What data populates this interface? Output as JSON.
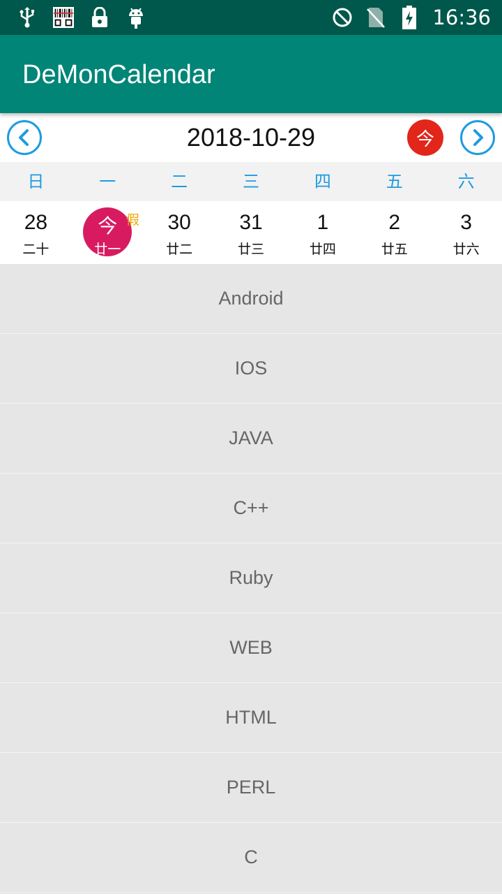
{
  "status_bar": {
    "time": "16:36",
    "left_icons": [
      "usb-icon",
      "barcode-icon",
      "lock-icon",
      "android-icon"
    ],
    "right_icons": [
      "do-not-disturb-icon",
      "no-sim-icon",
      "battery-charging-icon"
    ]
  },
  "app_bar": {
    "title": "DeMonCalendar"
  },
  "calendar": {
    "current_date": "2018-10-29",
    "today_label": "今",
    "weekdays": [
      "日",
      "一",
      "二",
      "三",
      "四",
      "五",
      "六"
    ],
    "days": [
      {
        "day": "28",
        "lunar": "二十",
        "selected": false
      },
      {
        "day": "今",
        "lunar": "廿一",
        "selected": true,
        "mark": "假"
      },
      {
        "day": "30",
        "lunar": "廿二",
        "selected": false
      },
      {
        "day": "31",
        "lunar": "廿三",
        "selected": false
      },
      {
        "day": "1",
        "lunar": "廿四",
        "selected": false
      },
      {
        "day": "2",
        "lunar": "廿五",
        "selected": false
      },
      {
        "day": "3",
        "lunar": "廿六",
        "selected": false
      }
    ]
  },
  "list": {
    "items": [
      "Android",
      "IOS",
      "JAVA",
      "C++",
      "Ruby",
      "WEB",
      "HTML",
      "PERL",
      "C"
    ]
  },
  "colors": {
    "status_bar": "#00574b",
    "app_bar": "#008577",
    "accent_blue": "#1e9be0",
    "today_red": "#e2261a",
    "selected_pink": "#d81b60",
    "holiday_orange": "#f0a500"
  }
}
